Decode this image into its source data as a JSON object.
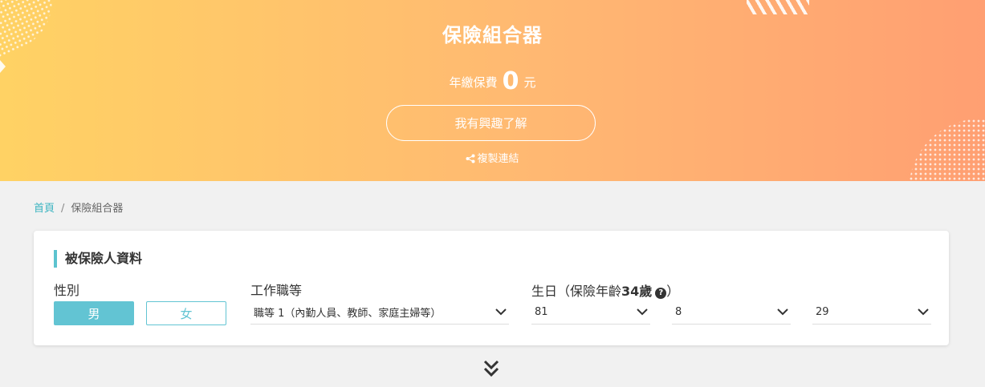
{
  "hero": {
    "title": "保險組合器",
    "price_prefix": "年繳保費",
    "price_value": "0",
    "price_unit": "元",
    "interest_button": "我有興趣了解",
    "copy_link": "複製連結"
  },
  "breadcrumb": {
    "home": "首頁",
    "separator": "/",
    "current": "保險組合器"
  },
  "insured": {
    "title": "被保險人資料",
    "gender_label": "性別",
    "gender_male": "男",
    "gender_female": "女",
    "selected_gender": "男",
    "job_label": "工作職等",
    "job_value": "職等 1（內勤人員、教師、家庭主婦等）",
    "birthday_label_prefix": "生日（保險年齡",
    "insurance_age": "34歲",
    "birthday_label_suffix": "）",
    "birth_year": "81",
    "birth_month": "8",
    "birth_day": "29"
  },
  "colors": {
    "accent": "#62c4d3",
    "hero_start": "#ffd264",
    "hero_end": "#ff9f72"
  },
  "icons": {
    "share": "share-icon",
    "help": "help-circle-icon",
    "chevron": "chevron-down-icon",
    "expand": "double-chevron-down-icon"
  }
}
